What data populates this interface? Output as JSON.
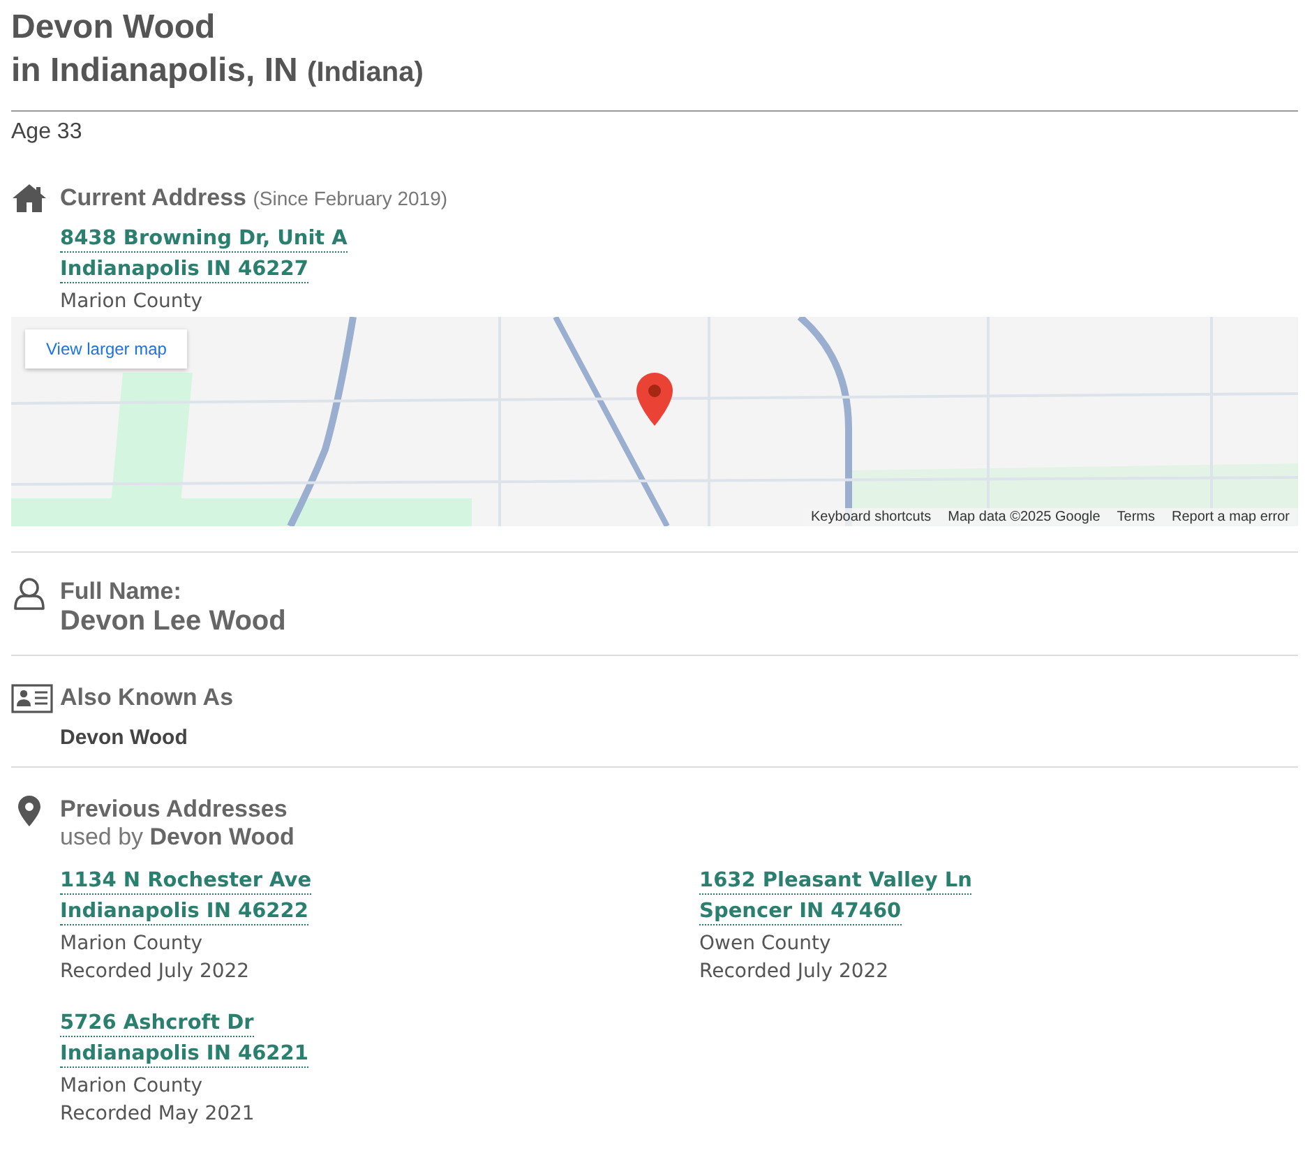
{
  "header": {
    "name": "Devon Wood",
    "location": "in Indianapolis, IN",
    "state": "(Indiana)",
    "age": "Age 33"
  },
  "current_address": {
    "heading": "Current Address",
    "since": "(Since February 2019)",
    "street": "8438 Browning Dr, Unit A",
    "city": "Indianapolis IN 46227",
    "county": "Marion County",
    "map": {
      "button": "View larger map",
      "footer": [
        "Keyboard shortcuts",
        "Map data ©2025 Google",
        "Terms",
        "Report a map error"
      ]
    }
  },
  "full_name": {
    "heading": "Full Name:",
    "value": "Devon Lee Wood"
  },
  "aliases": {
    "heading": "Also Known As",
    "values": [
      "Devon Wood"
    ]
  },
  "previous_addresses": {
    "heading": "Previous Addresses",
    "subtitle_prefix": "used by",
    "subtitle_name": "Devon Wood",
    "items": [
      {
        "street": "1134 N Rochester Ave",
        "city": "Indianapolis IN 46222",
        "county": "Marion County",
        "recorded": "Recorded July 2022"
      },
      {
        "street": "1632 Pleasant Valley Ln",
        "city": "Spencer IN 47460",
        "county": "Owen County",
        "recorded": "Recorded July 2022"
      },
      {
        "street": "5726 Ashcroft Dr",
        "city": "Indianapolis IN 46221",
        "county": "Marion County",
        "recorded": "Recorded May 2021"
      }
    ]
  }
}
